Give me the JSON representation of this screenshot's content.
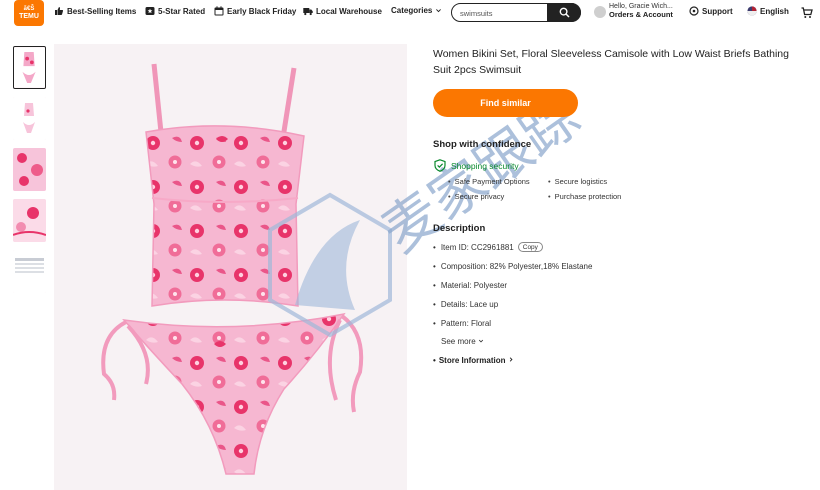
{
  "header": {
    "logo_top": "ã€Š",
    "logo_bottom": "TEMU",
    "nav": [
      {
        "label": "Best-Selling Items",
        "icon": "thumbs-up-icon"
      },
      {
        "label": "5-Star Rated",
        "icon": "star-badge-icon"
      },
      {
        "label": "Early Black Friday",
        "icon": "calendar-icon"
      },
      {
        "label": "Local Warehouse",
        "icon": "truck-icon"
      },
      {
        "label": "Categories",
        "icon": "chevron-down-icon"
      }
    ],
    "search": {
      "value": "swimsuits",
      "icon": "search-icon"
    },
    "account": {
      "greeting": "Hello, Gracie Wich...",
      "label": "Orders & Account"
    },
    "support": "Support",
    "language": "English",
    "cart_icon": "cart-icon"
  },
  "product": {
    "title": "Women Bikini Set, Floral Sleeveless Camisole with Low Waist Briefs Bathing Suit 2pcs Swimsuit",
    "find_similar": "Find similar",
    "shop_confidence": "Shop with confidence",
    "shopping_security": "Shopping security",
    "features": [
      "Safe Payment Options",
      "Secure logistics",
      "Secure privacy",
      "Purchase protection"
    ],
    "description_title": "Description",
    "item_id": "Item ID: CC2961881",
    "copy_label": "Copy",
    "details": [
      "Composition: 82% Polyester,18% Elastane",
      "Material: Polyester",
      "Details: Lace up",
      "Pattern: Floral"
    ],
    "see_more": "See more",
    "store_information": "Store Information"
  },
  "watermark_text": "麦家跟踪",
  "colors": {
    "accent": "#fb7701",
    "security_green": "#0a8a2d",
    "dark": "#222222",
    "bikini_pink": "#f4a8c8",
    "flower_red": "#e8346a"
  }
}
